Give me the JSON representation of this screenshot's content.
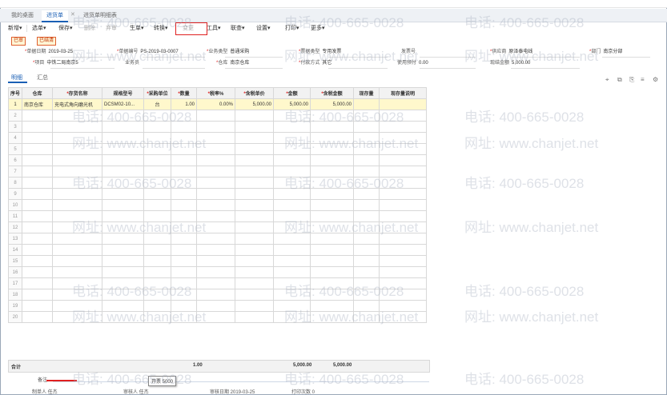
{
  "tabs": [
    {
      "label": "我的桌面"
    },
    {
      "label": "进货单"
    },
    {
      "label": "进货单明细表"
    }
  ],
  "toolbar": [
    {
      "label": "新增▾"
    },
    {
      "label": "选单▾"
    },
    {
      "label": "保存▾"
    },
    {
      "label": "删除"
    },
    {
      "label": "弃审"
    },
    {
      "label": "生单▾"
    },
    {
      "label": "转换▾"
    },
    {
      "label": "变更"
    },
    {
      "label": "工具▾"
    },
    {
      "label": "联查▾"
    },
    {
      "label": "设置▾"
    },
    {
      "label": "打印▾"
    },
    {
      "label": "更多▾"
    }
  ],
  "status_badges": [
    "已审",
    "已结清"
  ],
  "header_fields": {
    "date": {
      "label": "单据日期",
      "value": "2019-03-25"
    },
    "code": {
      "label": "单据编号",
      "value": "PS-2019-03-0007"
    },
    "biz_type": {
      "label": "业务类型",
      "value": "普通采购"
    },
    "invoice_type": {
      "label": "票据类型",
      "value": "专用发票"
    },
    "invoice_no": {
      "label": "发票号",
      "value": ""
    },
    "supplier": {
      "label": "供应商",
      "value": "原泽泰电线"
    },
    "dept": {
      "label": "部门",
      "value": "南京分部"
    },
    "project": {
      "label": "项目",
      "value": "中铁二局南京5"
    },
    "clerk": {
      "label": "业务员",
      "value": ""
    },
    "warehouse": {
      "label": "仓库",
      "value": "南京仓库"
    },
    "payment": {
      "label": "付款方式",
      "value": "其它"
    },
    "prepaid": {
      "label": "使用预付",
      "value": "0.00"
    },
    "cash": {
      "label": "现结金额",
      "value": "5,000.00"
    }
  },
  "subtabs": [
    "明细",
    "汇总"
  ],
  "grid": {
    "columns": [
      "序号",
      "仓库",
      "存货名称",
      "规格型号",
      "采购单位",
      "数量",
      "税率%",
      "含税单价",
      "金额",
      "含税金额",
      "现存量",
      "现存量说明"
    ],
    "required": [
      false,
      false,
      true,
      false,
      true,
      true,
      true,
      true,
      true,
      true,
      false,
      false
    ],
    "rows": [
      [
        "1",
        "南京仓库",
        "充电式角向磨光机",
        "DCSM02-10...",
        "台",
        "1.00",
        "0.00%",
        "5,000.00",
        "5,000.00",
        "5,000.00",
        "",
        ""
      ]
    ],
    "empty_row_count": 19
  },
  "totals": {
    "label": "合计",
    "qty": "1.00",
    "amount": "5,000.00",
    "tax_amount": "5,000.00"
  },
  "footer": {
    "remark_label": "备注",
    "maker": "制单人 任杰",
    "auditor": "审核人 任杰",
    "audit_date": "审核日期 2019-03-25",
    "print_count": "打印次数 0",
    "tooltip": "开票 5000"
  },
  "watermark": {
    "phone": "电话: 400-665-0028",
    "site": "网址: www.chanjet.net"
  }
}
